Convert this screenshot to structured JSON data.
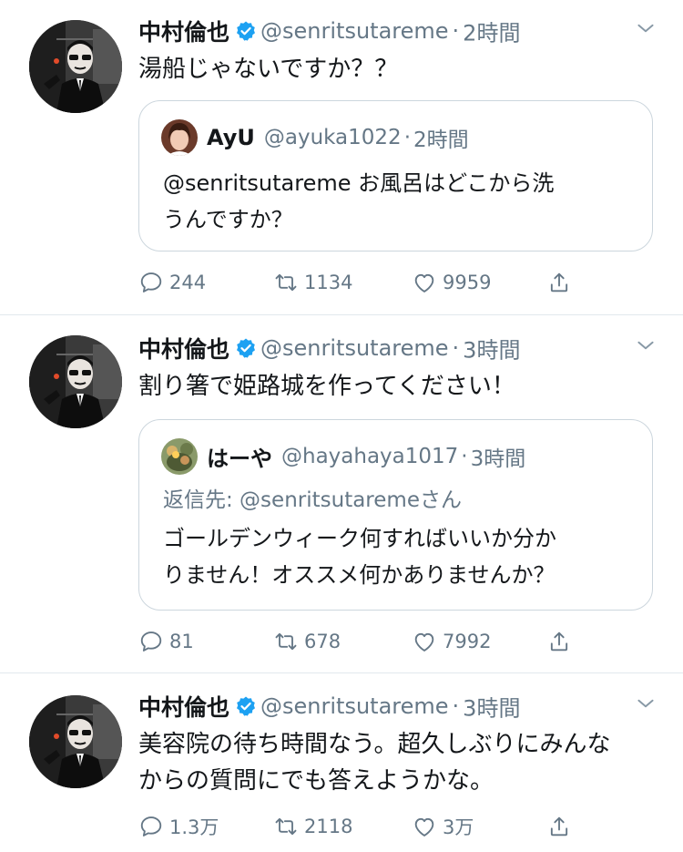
{
  "colors": {
    "secondary": "#657786",
    "verified": "#1da1f2",
    "border": "#e1e8ed"
  },
  "tweets": [
    {
      "user": {
        "name": "中村倫也",
        "handle": "@senritsutareme",
        "avatar_icon": "avatar-man-sunglasses"
      },
      "dot": "·",
      "time": "2時間",
      "text": "湯船じゃないですか？？",
      "quote": {
        "name": "AyU",
        "handle": "@ayuka1022",
        "dot": "·",
        "time": "2時間",
        "text_lines": [
          "@senritsutareme お風呂はどこから洗",
          "うんですか？"
        ]
      },
      "counts": {
        "reply": "244",
        "retweet": "1134",
        "like": "9959"
      }
    },
    {
      "user": {
        "name": "中村倫也",
        "handle": "@senritsutareme",
        "avatar_icon": "avatar-man-sunglasses"
      },
      "dot": "·",
      "time": "3時間",
      "text": "割り箸で姫路城を作ってください！",
      "quote": {
        "name": "はーや",
        "handle": "@hayahaya1017",
        "dot": "·",
        "time": "3時間",
        "reply_to": "返信先: @senritsutaremeさん",
        "text_lines": [
          "ゴールデンウィーク何すればいいか分か",
          "りません！オススメ何かありませんか？"
        ]
      },
      "counts": {
        "reply": "81",
        "retweet": "678",
        "like": "7992"
      }
    },
    {
      "user": {
        "name": "中村倫也",
        "handle": "@senritsutareme",
        "avatar_icon": "avatar-man-sunglasses"
      },
      "dot": "·",
      "time": "3時間",
      "text_lines": [
        "美容院の待ち時間なう。超久しぶりにみんな",
        "からの質問にでも答えようかな。"
      ],
      "counts": {
        "reply": "1.3万",
        "retweet": "2118",
        "like": "3万"
      }
    }
  ]
}
